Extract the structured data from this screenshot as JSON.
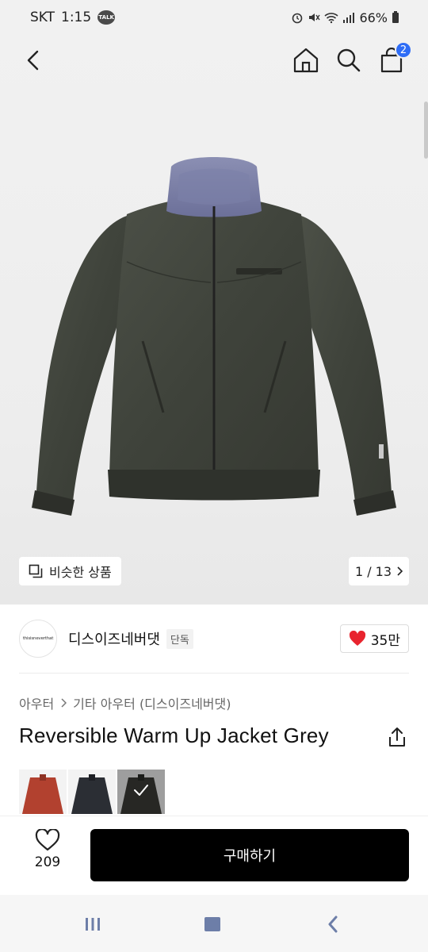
{
  "status_bar": {
    "carrier": "SKT",
    "time": "1:15",
    "talk_badge": "TALK",
    "battery": "66%"
  },
  "header": {
    "cart_count": "2",
    "icons": [
      "back-arrow-icon",
      "home-icon",
      "search-icon",
      "shopping-bag-icon"
    ]
  },
  "gallery": {
    "similar_label": "비슷한 상품",
    "pager": "1 / 13"
  },
  "brand": {
    "logo_text": "thisisneverthat",
    "name": "디스이즈네버댓",
    "badge": "단독",
    "likes": "35만"
  },
  "breadcrumb": {
    "category": "아우터",
    "subcategory": "기타 아우터 (디스이즈네버댓)"
  },
  "product": {
    "title": "Reversible Warm Up Jacket Grey"
  },
  "swatches": [
    {
      "color": "#b2412f"
    },
    {
      "color": "#2b2e34"
    },
    {
      "color": "#3c3d38"
    }
  ],
  "purchase": {
    "wish_count": "209",
    "buy_label": "구매하기"
  },
  "colors": {
    "accent_blue": "#2f6df6",
    "heart_red": "#e8242e",
    "buy_button": "#000000"
  }
}
